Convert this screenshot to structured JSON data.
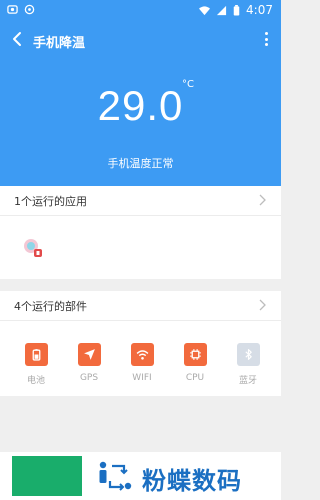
{
  "status_bar": {
    "time": "4:07",
    "color": "#3d9bf3"
  },
  "header": {
    "title": "手机降温",
    "back_icon": "chevron-left-icon",
    "more_icon": "more-vert-icon"
  },
  "temperature": {
    "value": "29.0",
    "unit": "°C",
    "status": "手机温度正常"
  },
  "apps_section": {
    "title": "1个运行的应用",
    "app_icon": "app-icon"
  },
  "parts_section": {
    "title": "4个运行的部件",
    "items": [
      {
        "label": "电池",
        "icon": "battery-icon",
        "active": true
      },
      {
        "label": "GPS",
        "icon": "location-arrow-icon",
        "active": true
      },
      {
        "label": "WIFI",
        "icon": "wifi-icon",
        "active": true
      },
      {
        "label": "CPU",
        "icon": "cpu-icon",
        "active": true
      },
      {
        "label": "蓝牙",
        "icon": "bluetooth-icon",
        "active": false
      }
    ]
  },
  "watermark": {
    "text": "粉蝶数码"
  },
  "colors": {
    "primary": "#3d9bf3",
    "part_active": "#f26a3d",
    "part_inactive": "#d6dde6",
    "watermark": "#1b6fc2",
    "green": "#19ad6b"
  }
}
